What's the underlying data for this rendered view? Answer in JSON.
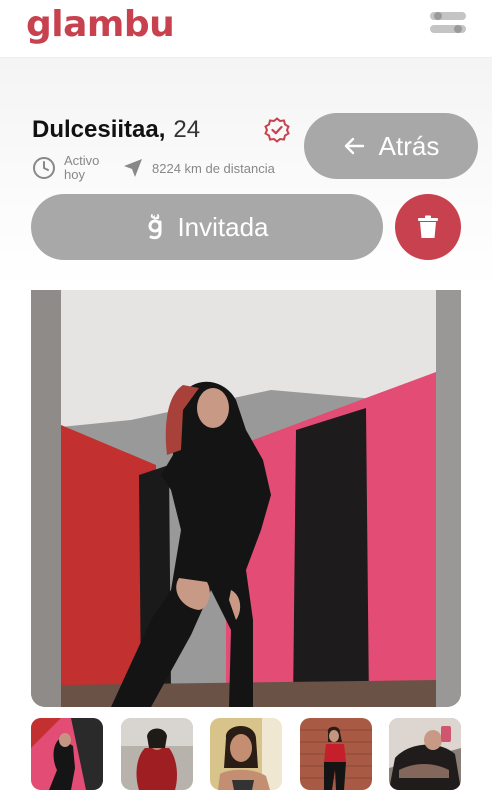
{
  "app": {
    "logo_text": "glambu",
    "brand_color": "#c8414f"
  },
  "header": {
    "menu_icon": "sliders-icon"
  },
  "profile": {
    "name": "Dulcesiitaa,",
    "age": "24",
    "verified_icon": "verified-badge-icon",
    "activity_status": "Activo hoy",
    "distance": "8224 km de distancia"
  },
  "actions": {
    "back_label": "Atrás",
    "invite_label": "Invitada",
    "delete_icon": "trash-icon"
  },
  "gallery": {
    "main_photo": "profile-photo",
    "thumbnails": [
      "thumb-1",
      "thumb-2",
      "thumb-3",
      "thumb-4",
      "thumb-5"
    ]
  }
}
